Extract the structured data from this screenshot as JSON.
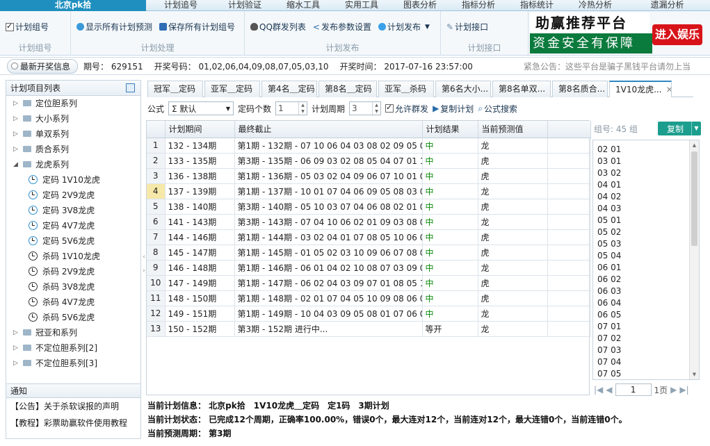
{
  "menu": {
    "tabs": [
      "北京pk拾",
      "计划追号",
      "计划验证",
      "缩水工具",
      "实用工具",
      "图表分析",
      "指标分析",
      "指标统计",
      "冷热分析",
      "遗漏分析"
    ]
  },
  "toolbar": {
    "group1": {
      "items": [
        "计划组号"
      ],
      "label": "计划组号"
    },
    "group2": {
      "items": [
        "显示所有计划预测",
        "保存所有计划组号"
      ],
      "label": "计划处理"
    },
    "group3": {
      "items": [
        "QQ群发列表",
        "发布参数设置",
        "计划发布"
      ],
      "label": "计划发布"
    },
    "group4": {
      "items": [
        "计划接口"
      ],
      "label": "计划接口"
    }
  },
  "banner": {
    "line1": "助赢推荐平台",
    "line2": "资金安全有保障",
    "cta": "进入娱乐"
  },
  "infobar": {
    "latest": "最新开奖信息",
    "period_label": "期号：",
    "period": "629151",
    "numbers_label": "开奖号码：",
    "numbers": "01,02,06,04,09,08,07,05,03,10",
    "time_label": "开奖时间：",
    "time": "2017-07-16 23:57:00",
    "notice": "紧急公告：这些平台是骗子黑钱平台请勿上当"
  },
  "sidebar": {
    "title": "计划项目列表",
    "groups_before": [
      {
        "label": "定位胆系列",
        "expanded": false
      },
      {
        "label": "大小系列",
        "expanded": false
      },
      {
        "label": "单双系列",
        "expanded": false
      },
      {
        "label": "质合系列",
        "expanded": false
      },
      {
        "label": "龙虎系列",
        "expanded": true
      }
    ],
    "children": [
      {
        "label": "定码 1V10龙虎",
        "style": "blue"
      },
      {
        "label": "定码 2V9龙虎",
        "style": "blue"
      },
      {
        "label": "定码 3V8龙虎",
        "style": "blue"
      },
      {
        "label": "定码 4V7龙虎",
        "style": "blue"
      },
      {
        "label": "定码 5V6龙虎",
        "style": "blue"
      },
      {
        "label": "杀码 1V10龙虎",
        "style": "dark"
      },
      {
        "label": "杀码 2V9龙虎",
        "style": "dark"
      },
      {
        "label": "杀码 3V8龙虎",
        "style": "dark"
      },
      {
        "label": "杀码 4V7龙虎",
        "style": "dark"
      },
      {
        "label": "杀码 5V6龙虎",
        "style": "dark"
      }
    ],
    "groups_after": [
      {
        "label": "冠亚和系列",
        "expanded": false
      },
      {
        "label": "不定位胆系列[2]",
        "expanded": false
      },
      {
        "label": "不定位胆系列[3]",
        "expanded": false
      }
    ]
  },
  "notices": {
    "title": "通知",
    "items": [
      "【公告】关于杀软误报的声明",
      "【教程】彩票助赢软件使用教程"
    ]
  },
  "tabs": [
    "冠军＿定码",
    "亚军＿定码",
    "第4名＿定码",
    "第8名＿定码",
    "亚军＿杀码",
    "第6名大小...",
    "第8名单双...",
    "第8名质合...",
    "1V10龙虎..."
  ],
  "formula": {
    "label": "公式",
    "value": "Σ 默认",
    "count_label": "定码个数",
    "count": "1",
    "cycle_label": "计划周期",
    "cycle": "3",
    "allow_group": "允许群发",
    "copy_plan": "复制计划",
    "search": "公式搜索"
  },
  "table": {
    "headers": [
      "计划期间",
      "最终截止",
      "计划结果",
      "当前预测值"
    ],
    "rows": [
      [
        "1",
        "132 - 134期",
        "第1期 - 132期 - 07 10 06 04 03 08 02 09 05 01",
        "中",
        "龙"
      ],
      [
        "2",
        "133 - 135期",
        "第3期 - 135期 - 06 09 03 02 08 05 04 07 01 10",
        "中",
        "虎"
      ],
      [
        "3",
        "136 - 138期",
        "第1期 - 136期 - 05 03 02 04 09 06 07 10 01 08",
        "中",
        "虎"
      ],
      [
        "4",
        "137 - 139期",
        "第1期 - 137期 - 10 01 07 04 06 09 05 08 03 02",
        "中",
        "龙"
      ],
      [
        "5",
        "138 - 140期",
        "第3期 - 140期 - 05 10 03 07 04 06 08 02 01 09",
        "中",
        "虎"
      ],
      [
        "6",
        "141 - 143期",
        "第3期 - 143期 - 07 04 10 06 02 01 09 03 08 05",
        "中",
        "龙"
      ],
      [
        "7",
        "144 - 146期",
        "第1期 - 144期 - 03 02 04 01 07 08 05 10 06 09",
        "中",
        "虎"
      ],
      [
        "8",
        "145 - 147期",
        "第1期 - 145期 - 01 05 02 03 10 09 06 07 08 04",
        "中",
        "虎"
      ],
      [
        "9",
        "146 - 148期",
        "第1期 - 146期 - 06 01 04 02 10 08 07 03 09 05",
        "中",
        "龙"
      ],
      [
        "10",
        "147 - 149期",
        "第1期 - 147期 - 06 02 04 03 09 07 01 08 05 10",
        "中",
        "虎"
      ],
      [
        "11",
        "148 - 150期",
        "第1期 - 148期 - 02 01 07 04 05 10 09 08 06 03",
        "中",
        "虎"
      ],
      [
        "12",
        "149 - 151期",
        "第1期 - 149期 - 10 04 03 09 05 08 01 07 06 02",
        "中",
        "龙"
      ],
      [
        "13",
        "150 - 152期",
        "第3期 - 152期 进行中...",
        "等开",
        "龙"
      ]
    ],
    "selected_row": 4
  },
  "group_panel": {
    "label": "组号: 45 组",
    "copy": "复制",
    "items": [
      "02 01",
      "03 01",
      "03 02",
      "04 01",
      "04 02",
      "04 03",
      "05 01",
      "05 02",
      "05 03",
      "05 04",
      "06 01",
      "06 02",
      "06 03",
      "06 04",
      "06 05",
      "07 01",
      "07 02",
      "07 03",
      "07 04",
      "07 05"
    ],
    "page": "1",
    "total_pages": "1页"
  },
  "status": {
    "line1": "当前计划信息： 北京pk拾　1V10龙虎＿定码　定1码　3期计划",
    "line2": "当前计划状态： 已完成12个周期，正确率100.00%，错误0个，最大连对12个，当前连对12个，最大连错0个，当前连错0个。",
    "line3": "当前预测周期： 第3期"
  }
}
